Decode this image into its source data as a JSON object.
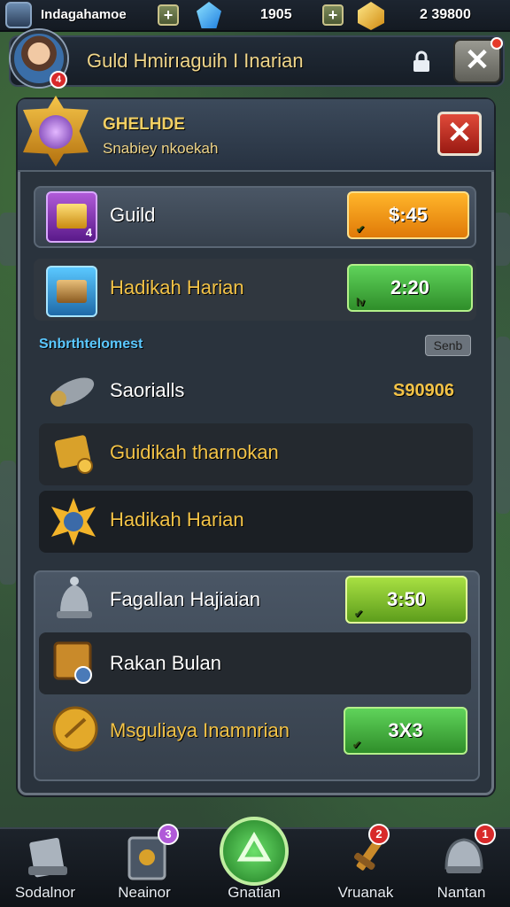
{
  "topbar": {
    "player_name": "Indagahamoe",
    "gems": "1905",
    "gold": "2 39800",
    "plus_label": "+"
  },
  "header": {
    "title": "Guld Hmirıaguih I Inarian",
    "avatar_badge": "4",
    "lock_icon": "lock-icon",
    "close_label": "✕"
  },
  "panel": {
    "title": "GHELHDE",
    "subtitle": "Snabiey nkoekah",
    "close_label": "✕",
    "rows_top": [
      {
        "label": "Guild",
        "button": "$:45",
        "icon_badge": "4"
      },
      {
        "label": "Hadikah Harian",
        "button": "2:20"
      }
    ],
    "section_label": "Snbrthtelomest",
    "sort_label": "Senb",
    "rows_list": [
      {
        "label": "Saorialls",
        "value": "S90906"
      },
      {
        "label": "Guidikah tharnokan"
      },
      {
        "label": "Hadikah Harian"
      }
    ],
    "rows_bottom": [
      {
        "label": "Fagallan Hajiaian",
        "button": "3:50"
      },
      {
        "label": "Rakan Bulan"
      },
      {
        "label": "Msguliaya Inamnrian",
        "button": "3X3"
      }
    ]
  },
  "nav": [
    {
      "label": "Sodalnor",
      "badge": ""
    },
    {
      "label": "Neainor",
      "badge": "3"
    },
    {
      "label": "Gnatian",
      "badge": ""
    },
    {
      "label": "Vruanak",
      "badge": "2"
    },
    {
      "label": "Nantan",
      "badge": "1"
    }
  ],
  "colors": {
    "accent_gold": "#f3c347",
    "section_blue": "#5ac8ff",
    "close_red": "#d82a2a"
  }
}
